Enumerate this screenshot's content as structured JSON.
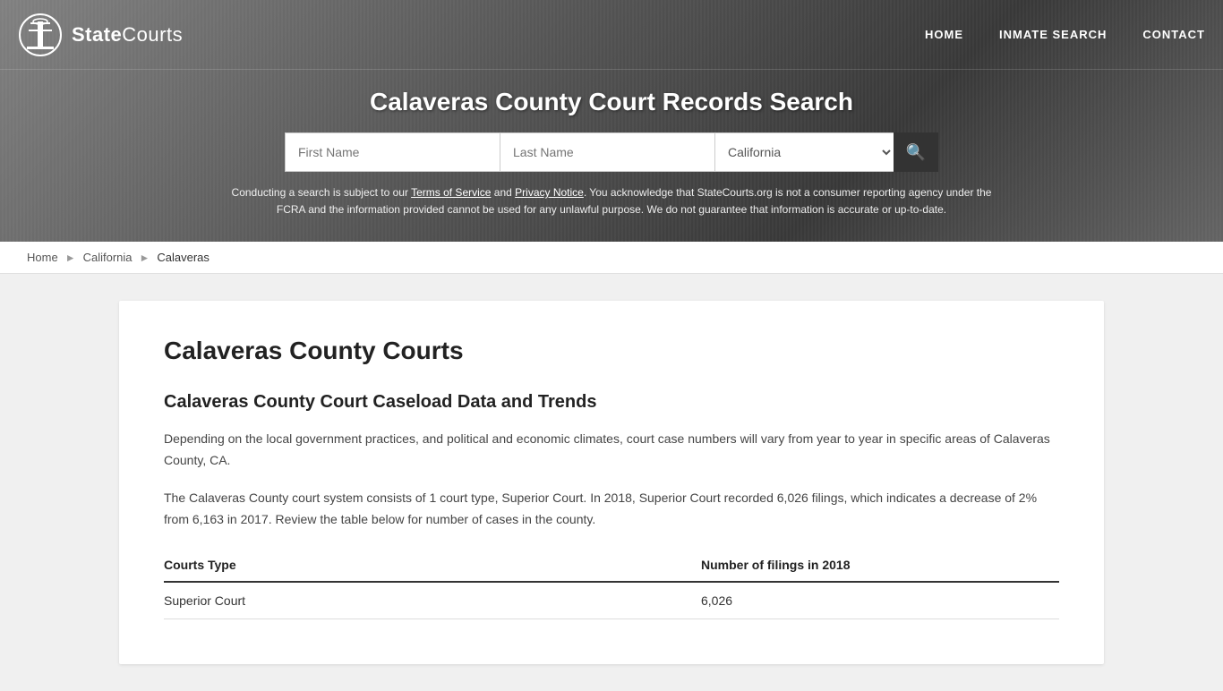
{
  "header": {
    "logo_text_bold": "State",
    "logo_text_light": "Courts",
    "page_title": "Calaveras County Court Records Search"
  },
  "nav": {
    "home_label": "HOME",
    "inmate_search_label": "INMATE SEARCH",
    "contact_label": "CONTACT"
  },
  "search": {
    "first_name_placeholder": "First Name",
    "last_name_placeholder": "Last Name",
    "state_select_label": "Select State",
    "search_icon": "🔍"
  },
  "disclaimer": {
    "text_before_tos": "Conducting a search is subject to our ",
    "tos_label": "Terms of Service",
    "text_between": " and ",
    "privacy_label": "Privacy Notice",
    "text_after": ". You acknowledge that StateCourts.org is not a consumer reporting agency under the FCRA and the information provided cannot be used for any unlawful purpose. We do not guarantee that information is accurate or up-to-date."
  },
  "breadcrumb": {
    "home_label": "Home",
    "state_label": "California",
    "county_label": "Calaveras"
  },
  "content": {
    "county_title": "Calaveras County Courts",
    "section_title": "Calaveras County Court Caseload Data and Trends",
    "paragraph1": "Depending on the local government practices, and political and economic climates, court case numbers will vary from year to year in specific areas of Calaveras County, CA.",
    "paragraph2": "The Calaveras County court system consists of 1 court type, Superior Court. In 2018, Superior Court recorded 6,026 filings, which indicates a decrease of 2% from 6,163 in 2017. Review the table below for number of cases in the county.",
    "table": {
      "col1_header": "Courts Type",
      "col2_header": "Number of filings in 2018",
      "rows": [
        {
          "type": "Superior Court",
          "filings": "6,026"
        }
      ]
    }
  }
}
